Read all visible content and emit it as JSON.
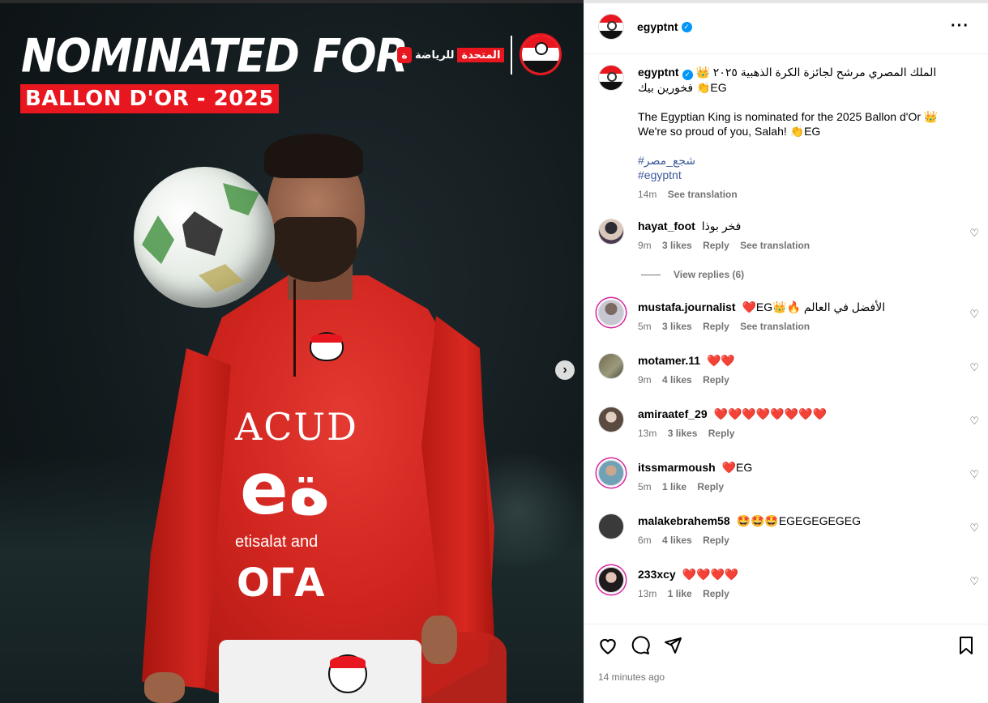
{
  "media": {
    "headline": "NOMINATED FOR",
    "ballon": "BALLON D'OR - 2025",
    "brand_text": "المتحدة",
    "brand_sub": "للرياضة",
    "sponsor_line1": "ACUD",
    "sponsor_line2": "eة",
    "sponsor_line3": "etisalat and",
    "sponsor_line4": "ОГА"
  },
  "header": {
    "username": "egyptnt",
    "verified": true
  },
  "caption": {
    "username": "egyptnt",
    "arabic_line": "الملك المصري مرشح لجائزة الكرة الذهبية ٢٠٢٥ 👑 فخورين بيك 👏EG",
    "english_line1": "The Egyptian King is nominated for the 2025 Ballon d'Or 👑",
    "english_line2": "We're so proud of you, Salah! 👏EG",
    "hashtag1": "#شجع_مصر",
    "hashtag2": "#egyptnt",
    "time": "14m",
    "see_translation": "See translation"
  },
  "comments": [
    {
      "username": "hayat_foot",
      "text": "فخر بوذا",
      "time": "9m",
      "likes": "3 likes",
      "reply": "Reply",
      "translate": "See translation"
    },
    {
      "view_replies": "View replies (6)"
    },
    {
      "username": "mustafa.journalist",
      "text": "❤️EG👑🔥 الأفضل في العالم",
      "time": "5m",
      "likes": "3 likes",
      "reply": "Reply",
      "translate": "See translation"
    },
    {
      "username": "motamer.11",
      "text": "❤️❤️",
      "time": "9m",
      "likes": "4 likes",
      "reply": "Reply"
    },
    {
      "username": "amiraatef_29",
      "text": "❤️❤️❤️❤️❤️❤️❤️❤️",
      "time": "13m",
      "likes": "3 likes",
      "reply": "Reply"
    },
    {
      "username": "itssmarmoush",
      "text": "❤️EG",
      "time": "5m",
      "likes": "1 like",
      "reply": "Reply"
    },
    {
      "username": "malakebrahem58",
      "text": "🤩🤩🤩EGEGEGEGEG",
      "time": "6m",
      "likes": "4 likes",
      "reply": "Reply"
    },
    {
      "username": "233xcy",
      "text": "❤️❤️❤️❤️",
      "time": "13m",
      "likes": "1 like",
      "reply": "Reply"
    }
  ],
  "footer": {
    "time_ago": "14 minutes ago"
  },
  "icons": {
    "like": "heart-outline-icon",
    "comment": "comment-bubble-icon",
    "share": "send-icon",
    "save": "bookmark-icon",
    "more": "more-horizontal-icon",
    "next": "chevron-right-icon"
  },
  "colors": {
    "accent_red": "#e8161e",
    "verified_blue": "#0095f6",
    "meta_gray": "#737373",
    "heart_red": "#e0262b"
  }
}
